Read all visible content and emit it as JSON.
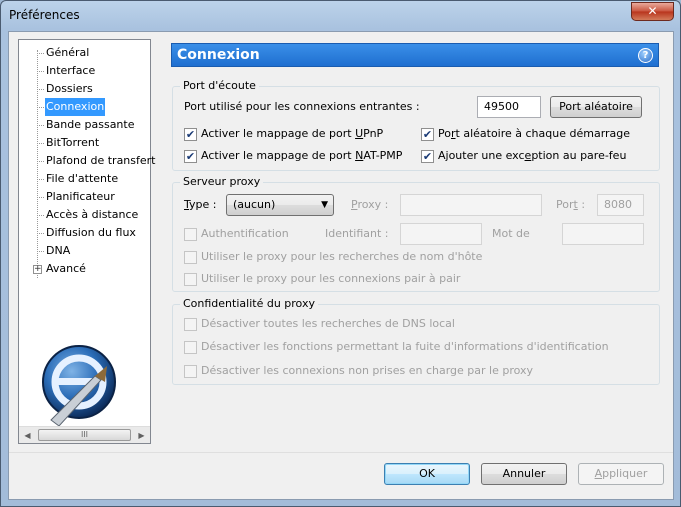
{
  "window": {
    "title": "Préférences",
    "close_glyph": "✕"
  },
  "tree": {
    "items": [
      {
        "label": "Général"
      },
      {
        "label": "Interface"
      },
      {
        "label": "Dossiers"
      },
      {
        "label": "Connexion",
        "selected": true
      },
      {
        "label": "Bande passante"
      },
      {
        "label": "BitTorrent"
      },
      {
        "label": "Plafond de transfert"
      },
      {
        "label": "File d'attente"
      },
      {
        "label": "Planificateur"
      },
      {
        "label": "Accès à distance"
      },
      {
        "label": "Diffusion du flux"
      },
      {
        "label": "DNA"
      },
      {
        "label": "Avancé",
        "expander": "+"
      }
    ],
    "scroll_left": "◀",
    "scroll_right": "▶",
    "scroll_grip": "III"
  },
  "header": {
    "title": "Connexion",
    "help_glyph": "?"
  },
  "port": {
    "legend": "Port d'écoute",
    "incoming_label": "Port utilisé pour les connexions entrantes :",
    "incoming_value": "49500",
    "random_button": "Port aléatoire",
    "upnp_pre": "Activer le mappage de port ",
    "upnp_key": "U",
    "upnp_post": "PnP",
    "natpmp_pre": "Activer le mappage de port ",
    "natpmp_key": "N",
    "natpmp_post": "AT-PMP",
    "random_start_pre": "Po",
    "random_start_key": "r",
    "random_start_post": "t aléatoire à chaque démarrage",
    "firewall_pre": "Ajouter une exc",
    "firewall_key": "e",
    "firewall_post": "ption au pare-feu",
    "checked_glyph": "✔"
  },
  "proxy": {
    "legend": "Serveur proxy",
    "type_key": "T",
    "type_rest": "ype :",
    "type_value": "(aucun)",
    "proxy_key": "P",
    "proxy_rest": "roxy :",
    "port_pre": "Por",
    "port_key": "t",
    "port_post": " :",
    "port_value": "8080",
    "auth_label": "Authentification",
    "identifiant_label": "Identifiant :",
    "password_label": "Mot de",
    "hostname_label": "Utiliser le proxy pour les recherches de nom d'hôte",
    "p2p_label": "Utiliser le proxy pour les connexions pair à pair"
  },
  "privacy": {
    "legend": "Confidentialité du proxy",
    "dns_label": "Désactiver toutes les recherches de DNS local",
    "leak_label": "Désactiver les fonctions permettant la fuite d'informations d'identification",
    "unsupported_label": "Désactiver les connexions non prises en charge par le proxy"
  },
  "footer": {
    "ok": "OK",
    "cancel": "Annuler",
    "apply_key": "A",
    "apply_rest": "ppliquer"
  }
}
